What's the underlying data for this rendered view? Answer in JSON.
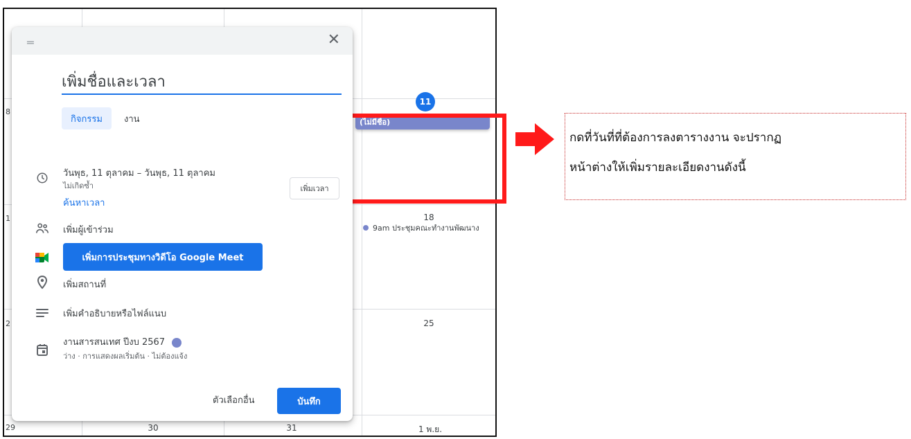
{
  "calendar": {
    "edge_numbers": [
      "8",
      "1",
      "2",
      "29"
    ],
    "today_number": "11",
    "untitled_event": "(ไม่มีชื่อ)",
    "week2_day": "18",
    "week2_event": "9am ประชุมคณะทำงานพัฒนาง",
    "week3_day": "25",
    "bottom_days": [
      "30",
      "31",
      "1 พ.ย."
    ]
  },
  "dialog": {
    "title_placeholder": "เพิ่มชื่อและเวลา",
    "tabs": {
      "event": "กิจกรรม",
      "task": "งาน"
    },
    "date_range": "วันพุธ, 11 ตุลาคม  –  วันพุธ, 11 ตุลาคม",
    "repeat": "ไม่เกิดซ้ำ",
    "add_time": "เพิ่มเวลา",
    "find_time": "ค้นหาเวลา",
    "add_guests": "เพิ่มผู้เข้าร่วม",
    "meet_button": "เพิ่มการประชุมทางวิดีโอ Google Meet",
    "add_location": "เพิ่มสถานที่",
    "add_description": "เพิ่มคำอธิบายหรือไฟล์แนบ",
    "calendar_name": "งานสารสนเทศ ปีงบ 2567",
    "calendar_sub": "ว่าง · การแสดงผลเริ่มต้น · ไม่ต้องแจ้ง",
    "more_options": "ตัวเลือกอื่น",
    "save": "บันทึก"
  },
  "annotation": {
    "line1": "กดที่วันที่ที่ต้องการลงตารางงาน จะปรากฏ",
    "line2": "หน้าต่างให้เพิ่มรายละเอียดงานดังนี้"
  },
  "colors": {
    "accent": "#1a73e8",
    "event": "#7986cb",
    "highlight": "#ff1a1a"
  }
}
